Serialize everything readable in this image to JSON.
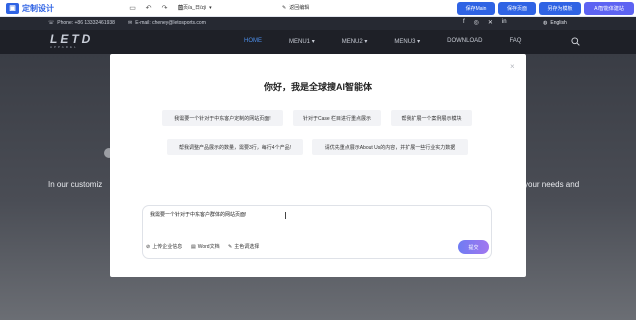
{
  "editor_bar": {
    "brand": "定制设计",
    "brand_mark": "▣",
    "page_selector": "首页/a_日/zji",
    "return_edit": "返回编辑",
    "buttons": {
      "save_main": "保存Main",
      "save_page": "保存页面",
      "save_template": "另存为模板",
      "ai_assistant": "AI智能体建站"
    }
  },
  "site_top": {
    "phone": "Phone: +86 13332461938",
    "email": "E-mail: cheney@letosports.com",
    "language": "English",
    "social_icons": [
      "facebook-icon",
      "instagram-icon",
      "twitter-icon",
      "linkedin-icon"
    ]
  },
  "site_nav": {
    "logo": "LETD",
    "logo_sub": "APPAREL",
    "items": [
      "HOME",
      "MENU1",
      "MENU2",
      "MENU3",
      "DOWNLOAD",
      "FAQ"
    ],
    "active_index": 0
  },
  "hero": {
    "text_left": "In our customiz",
    "text_right": "your needs and"
  },
  "modal": {
    "close": "×",
    "title": "你好，我是全球搜AI智能体",
    "suggestions": [
      "我需要一个针对于中东客户定制的网站页面!",
      "针对于Case 栏目进行重点展示",
      "帮我扩展一个案例展示模块",
      "帮我调整产品展示的数量，需要3行，每行4个产品!",
      "请优先重点展示About Us的内容，并扩展一些行业实力数据"
    ],
    "input_value": "我需要一个针对于中东客户群体的网站页面!",
    "tools": {
      "upload": "上传企业信息",
      "word": "Word文档",
      "pick": "主色调选择"
    },
    "send": "提交"
  },
  "colors": {
    "accent": "#2f63e4",
    "ai_button": "#5d63f2",
    "nav_active": "#4c8de8"
  }
}
